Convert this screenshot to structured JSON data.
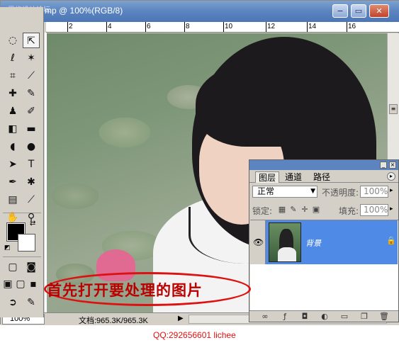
{
  "app": {
    "watermark": "思缘设计论坛",
    "title": "mp @ 100%(RGB/8)",
    "window_buttons": {
      "minimize": "−",
      "restore": "▭",
      "close": "✕"
    }
  },
  "ruler": {
    "ticks": [
      "2",
      "4",
      "6",
      "8",
      "10",
      "12",
      "14",
      "16"
    ]
  },
  "toolbox": {
    "tools": [
      {
        "name": "marquee-icon",
        "glyph": "◌"
      },
      {
        "name": "move-icon",
        "glyph": "⇱"
      },
      {
        "name": "lasso-icon",
        "glyph": "ℓ"
      },
      {
        "name": "magic-wand-icon",
        "glyph": "✶"
      },
      {
        "name": "crop-icon",
        "glyph": "⌗"
      },
      {
        "name": "slice-icon",
        "glyph": "⟋"
      },
      {
        "name": "healing-brush-icon",
        "glyph": "✚"
      },
      {
        "name": "brush-icon",
        "glyph": "✎"
      },
      {
        "name": "stamp-icon",
        "glyph": "♟"
      },
      {
        "name": "history-brush-icon",
        "glyph": "✐"
      },
      {
        "name": "eraser-icon",
        "glyph": "◧"
      },
      {
        "name": "gradient-icon",
        "glyph": "▬"
      },
      {
        "name": "blur-icon",
        "glyph": "◖"
      },
      {
        "name": "dodge-icon",
        "glyph": "●"
      },
      {
        "name": "path-select-icon",
        "glyph": "➤"
      },
      {
        "name": "type-icon",
        "glyph": "T"
      },
      {
        "name": "pen-icon",
        "glyph": "✒"
      },
      {
        "name": "shape-icon",
        "glyph": "✱"
      },
      {
        "name": "notes-icon",
        "glyph": "▤"
      },
      {
        "name": "eyedropper-icon",
        "glyph": "⟋"
      },
      {
        "name": "hand-icon",
        "glyph": "✋"
      },
      {
        "name": "zoom-icon",
        "glyph": "⚲"
      }
    ],
    "colors": {
      "foreground": "#000000",
      "background": "#ffffff"
    }
  },
  "status": {
    "zoom": "100%",
    "doc_info": "文档:965.3K/965.3K",
    "arrow": "▶"
  },
  "layers_panel": {
    "tabs": [
      {
        "label": "图层",
        "active": true
      },
      {
        "label": "通道"
      },
      {
        "label": "路径"
      }
    ],
    "blend_mode": "正常",
    "opacity_label": "不透明度:",
    "opacity_value": "100%",
    "lock_label": "锁定:",
    "fill_label": "填充:",
    "fill_value": "100%",
    "layer": {
      "name": "背景",
      "visible": true,
      "locked": true
    }
  },
  "annotation": {
    "text": "首先打开要处理的图片"
  },
  "credit": "QQ:292656601 lichee"
}
